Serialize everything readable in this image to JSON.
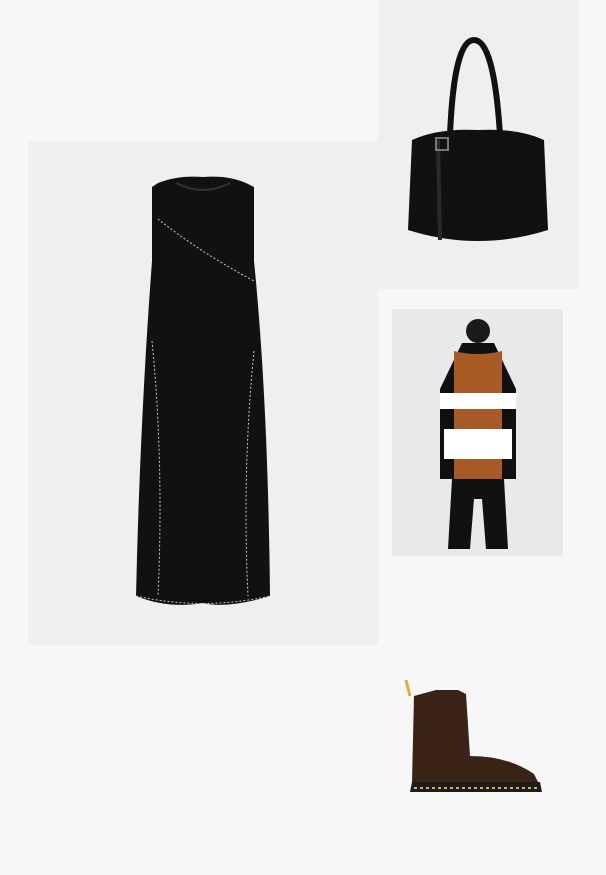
{
  "items": [
    {
      "name": "dress",
      "icon": "black-sleeveless-midi-dress"
    },
    {
      "name": "bag",
      "icon": "black-leather-tote-bag"
    },
    {
      "name": "cardigan",
      "icon": "colorblock-long-cardigan"
    },
    {
      "name": "boot",
      "icon": "brown-leather-ankle-boot"
    }
  ],
  "colors": {
    "background": "#f7f7f7",
    "tile": "#efefef",
    "dress": "#111111",
    "bag": "#0f0f0f",
    "cardigan_rust": "#a65a24",
    "boot": "#3a2418"
  }
}
